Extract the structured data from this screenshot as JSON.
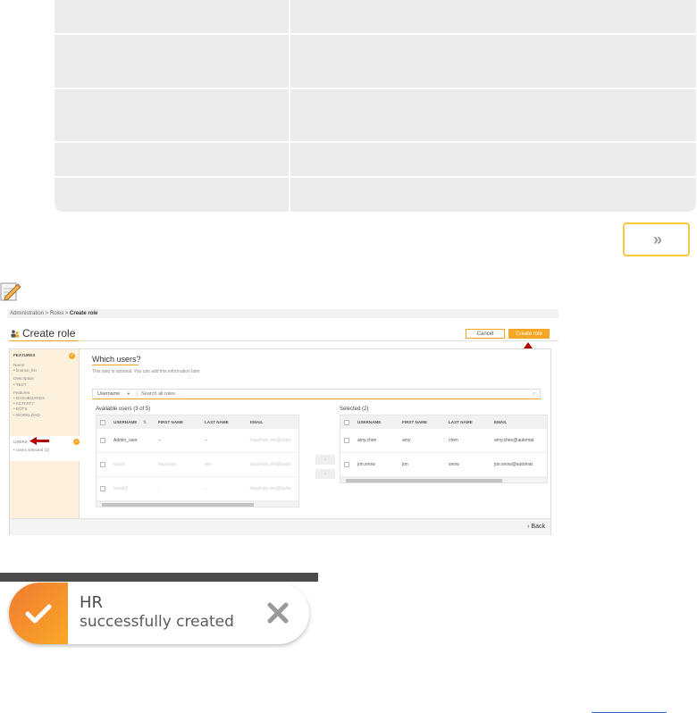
{
  "top_table": {
    "rows": 5
  },
  "next_button": {
    "label": "»"
  },
  "icons": {
    "note": "note-pencil-icon",
    "user_group": "user-group-icon",
    "search": "search-icon",
    "check": "check-icon",
    "close": "close-icon"
  },
  "colors": {
    "accent": "#f5a623",
    "toast_gradient_start": "#f07a33",
    "annotation_arrow": "#b30000"
  },
  "screenshot": {
    "breadcrumb": [
      "Administration",
      "Roles",
      "Create role"
    ],
    "title": "Create role",
    "buttons": {
      "cancel": "Cancel",
      "create": "Create role",
      "back": "‹ Back"
    },
    "steps": {
      "features": {
        "label": "FEATURES",
        "name_label": "Name",
        "name_value": "• finance_list",
        "desc_label": "Description",
        "desc_value": "• TEST",
        "features_label": "Features",
        "features": [
          "• DASHBOARDS",
          "• ACTIVITY",
          "• BOTS",
          "• WORKLOAD"
        ]
      },
      "users": {
        "label": "USERS",
        "value": "• Users selected (2)"
      }
    },
    "section": {
      "title": "Which users?",
      "subtitle": "This step is optional. You can add this information later"
    },
    "search": {
      "select": "Username",
      "placeholder": "Search all roles"
    },
    "available": {
      "label": "Available users (3 of 5)",
      "columns": [
        "USERNAME",
        "FIRST NAME",
        "LAST NAME",
        "EMAIL"
      ],
      "rows": [
        {
          "username": "Admin_user",
          "first": "--",
          "last": "--",
          "email": "kaushani.sen@autom"
        },
        {
          "username": "kaush",
          "first": "kaushani",
          "last": "sen",
          "email": "kaushani.sen@autom"
        },
        {
          "username": "kaush2",
          "first": "--",
          "last": "--",
          "email": "kaushani.sen@autom"
        }
      ]
    },
    "selected": {
      "label": "Selected (2)",
      "columns": [
        "USERNAME",
        "FIRST NAME",
        "LAST NAME",
        "EMAIL"
      ],
      "rows": [
        {
          "username": "amy.chen",
          "first": "amy",
          "last": "chen",
          "email": "amy.chen@automat"
        },
        {
          "username": "jon.snow",
          "first": "jon",
          "last": "snow",
          "email": "jon.snow@automat"
        }
      ]
    },
    "transfer": {
      "add": "›",
      "remove": "‹"
    }
  },
  "toast": {
    "title": "HR",
    "message": "successfully created"
  }
}
